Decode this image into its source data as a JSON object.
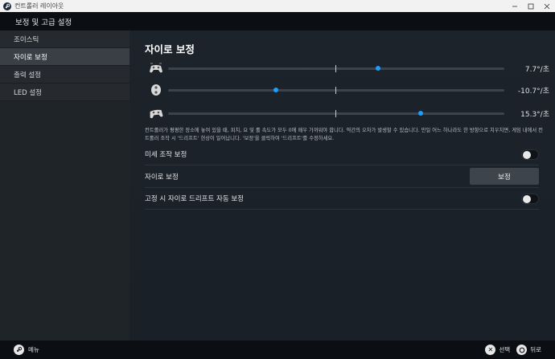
{
  "window": {
    "title": "컨트롤러 레이아웃"
  },
  "header": {
    "title": "보정 및 고급 설정"
  },
  "sidebar": {
    "items": [
      {
        "label": "조이스틱",
        "active": false
      },
      {
        "label": "자이로 보정",
        "active": true
      },
      {
        "label": "출력 설정",
        "active": false
      },
      {
        "label": "LED 설정",
        "active": false
      }
    ]
  },
  "main": {
    "title": "자이로 보정",
    "axes": [
      {
        "icon": "controller-yaw-icon",
        "value_label": "7.7°/초",
        "value": 7.7
      },
      {
        "icon": "controller-pitch-icon",
        "value_label": "-10.7°/초",
        "value": -10.7
      },
      {
        "icon": "controller-roll-icon",
        "value_label": "15.3°/초",
        "value": 15.3
      }
    ],
    "description": "컨트롤러가 평평한 장소에 놓여 있을 때, 피치, 요 및 롤 속도가 모두 0에 매우 가까워야 합니다. 약간의 오차가 발생할 수 있습니다. 만일 어느 하나라도 한 방향으로 치우치면, 게임 내에서 컨트롤러 조작 시 '드리프트' 현상이 일어납니다. '보정'을 클릭하여 '드리프트'를 수정하세요.",
    "settings": {
      "fine_tune_label": "미세 조작 보정",
      "fine_tune_on": false,
      "gyro_calib_label": "자이로 보정",
      "calibrate_button": "보정",
      "auto_drift_label": "고정 시 자이로 드리프트 자동 보정",
      "auto_drift_on": false
    }
  },
  "footer": {
    "menu_label": "메뉴",
    "select_label": "선택",
    "back_label": "뒤로"
  },
  "colors": {
    "accent": "#1a9fff"
  }
}
